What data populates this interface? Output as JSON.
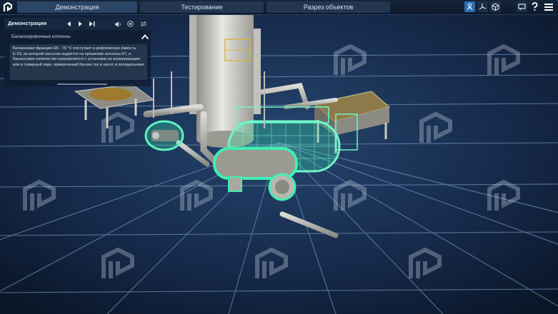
{
  "topbar": {
    "tabs": [
      {
        "label": "Демонстрация",
        "active": true
      },
      {
        "label": "Тестирование",
        "active": false
      },
      {
        "label": "Разрез объектов",
        "active": false
      }
    ],
    "icons": [
      "person-icon",
      "axes-icon",
      "cube-icon",
      "chat-icon",
      "help-icon",
      "menu-icon"
    ]
  },
  "panel": {
    "title": "Демонстрация",
    "section": "Балансировочные колонны",
    "description": "Бензиновая фракция НК - 70 °С поступает в рефлюксную ёмкость Е-23, из которой насосом подаётся на орошение колонны К7, а балансовое количество направляется с установки на изомеризацию или в товарный парк, прямогонный бензин газ и насос в холодильнике"
  },
  "colors": {
    "background": "#0c1c33",
    "grid": "#5d7fa6",
    "highlight": "#3ef0b2",
    "accent": "#2c6fb2"
  }
}
